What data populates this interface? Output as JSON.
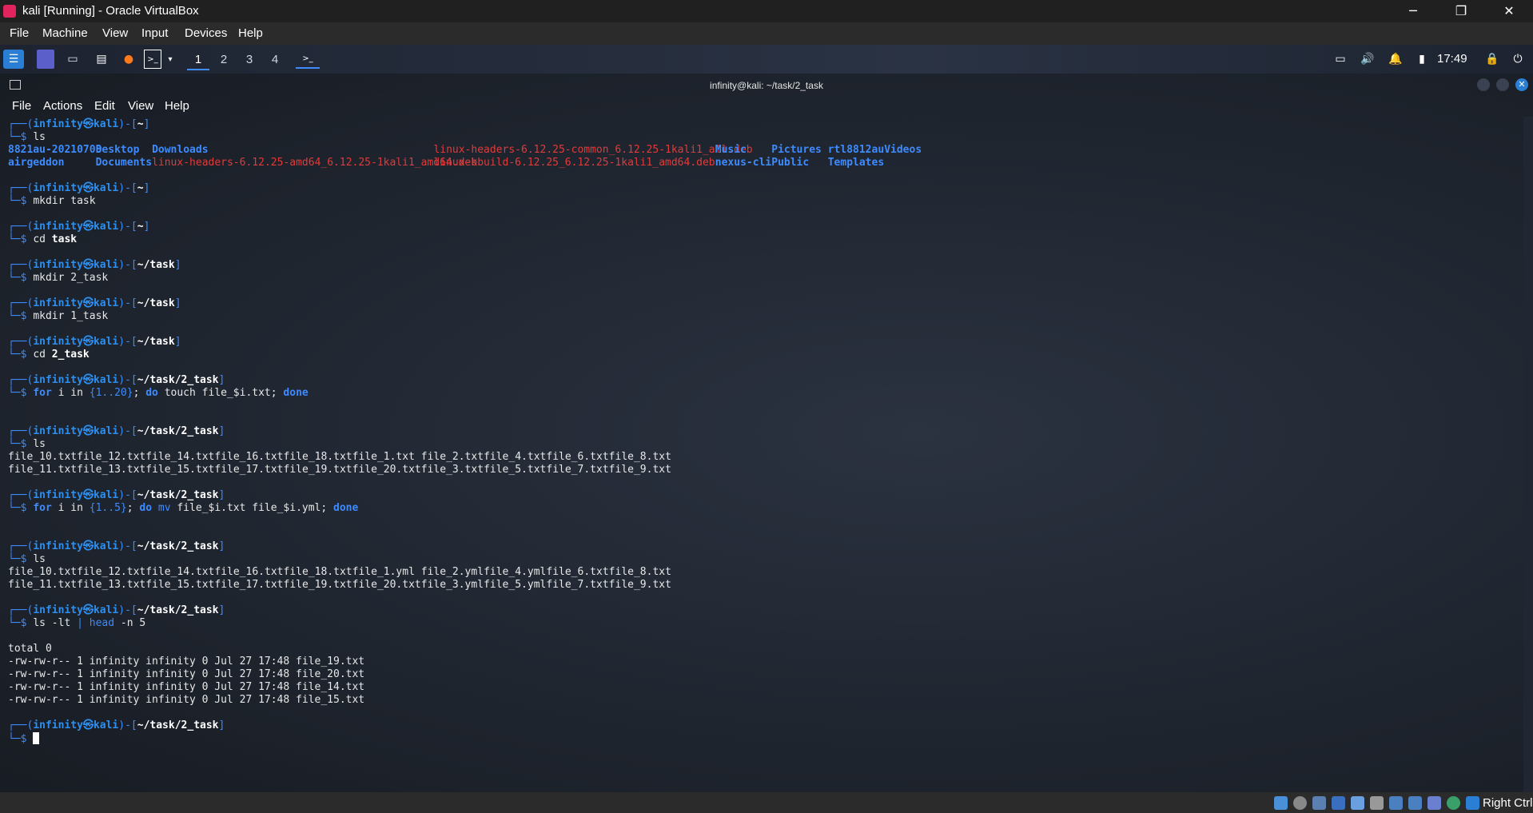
{
  "window": {
    "title": "kali [Running] - Oracle VirtualBox",
    "minimize": "─",
    "restore": "❐",
    "close": "✕"
  },
  "vb_menu": [
    "File",
    "Machine",
    "View",
    "Input",
    "Devices",
    "Help"
  ],
  "panel": {
    "workspaces": [
      "1",
      "2",
      "3",
      "4"
    ],
    "clock": "17:49"
  },
  "terminal": {
    "title": "infinity@kali: ~/task/2_task",
    "menu": [
      "File",
      "Actions",
      "Edit",
      "View",
      "Help"
    ],
    "prompt_user": "infinity",
    "prompt_host": "kali",
    "prompt_sym": "㉿",
    "blocks": [
      {
        "path": "~",
        "cmd": "ls"
      },
      {
        "path": "~",
        "cmd": "mkdir task"
      },
      {
        "path": "~",
        "cmd": "cd task"
      },
      {
        "path": "~/task",
        "cmd": "mkdir 2_task"
      },
      {
        "path": "~/task",
        "cmd": "mkdir 1_task"
      },
      {
        "path": "~/task",
        "cmd": "cd 2_task"
      },
      {
        "path": "~/task/2_task",
        "cmd": "for i in {1..20}; do touch file_$i.txt; done"
      },
      {
        "path": "~/task/2_task",
        "cmd": "ls"
      },
      {
        "path": "~/task/2_task",
        "cmd": "for i in {1..5}; do mv file_$i.txt file_$i.yml; done"
      },
      {
        "path": "~/task/2_task",
        "cmd": "ls"
      },
      {
        "path": "~/task/2_task",
        "cmd": "ls -lt | head -n 5"
      },
      {
        "path": "~/task/2_task",
        "cmd": ""
      }
    ],
    "home_ls": {
      "row1": [
        [
          "8821au-20210708",
          "dir"
        ],
        [
          "Desktop",
          "dir"
        ],
        [
          "Downloads",
          "dir"
        ],
        [
          "linux-headers-6.12.25-common_6.12.25-1kali1_all.deb",
          "deb"
        ],
        [
          "Music",
          "dir"
        ],
        [
          "Pictures",
          "dir"
        ],
        [
          "rtl8812au",
          "dir"
        ],
        [
          "Videos",
          "dir"
        ]
      ],
      "row2": [
        [
          "airgeddon",
          "dir"
        ],
        [
          "Documents",
          "dir"
        ],
        [
          "linux-headers-6.12.25-amd64_6.12.25-1kali1_amd64.deb",
          "deb"
        ],
        [
          "linux-kbuild-6.12.25_6.12.25-1kali1_amd64.deb",
          "deb"
        ],
        [
          "nexus-cli",
          "dir"
        ],
        [
          "Public",
          "dir"
        ],
        [
          "Templates",
          "dir"
        ]
      ]
    },
    "ls1": {
      "row1": [
        "file_10.txt",
        "file_12.txt",
        "file_14.txt",
        "file_16.txt",
        "file_18.txt",
        "file_1.txt",
        "file_2.txt",
        "file_4.txt",
        "file_6.txt",
        "file_8.txt"
      ],
      "row2": [
        "file_11.txt",
        "file_13.txt",
        "file_15.txt",
        "file_17.txt",
        "file_19.txt",
        "file_20.txt",
        "file_3.txt",
        "file_5.txt",
        "file_7.txt",
        "file_9.txt"
      ]
    },
    "ls2": {
      "row1": [
        "file_10.txt",
        "file_12.txt",
        "file_14.txt",
        "file_16.txt",
        "file_18.txt",
        "file_1.yml",
        "file_2.yml",
        "file_4.yml",
        "file_6.txt",
        "file_8.txt"
      ],
      "row2": [
        "file_11.txt",
        "file_13.txt",
        "file_15.txt",
        "file_17.txt",
        "file_19.txt",
        "file_20.txt",
        "file_3.yml",
        "file_5.yml",
        "file_7.txt",
        "file_9.txt"
      ]
    },
    "ls_lt": [
      "total 0",
      "-rw-rw-r-- 1 infinity infinity 0 Jul 27 17:48 file_19.txt",
      "-rw-rw-r-- 1 infinity infinity 0 Jul 27 17:48 file_20.txt",
      "-rw-rw-r-- 1 infinity infinity 0 Jul 27 17:48 file_14.txt",
      "-rw-rw-r-- 1 infinity infinity 0 Jul 27 17:48 file_15.txt"
    ]
  },
  "statusbar": {
    "host_key": "Right Ctrl"
  }
}
